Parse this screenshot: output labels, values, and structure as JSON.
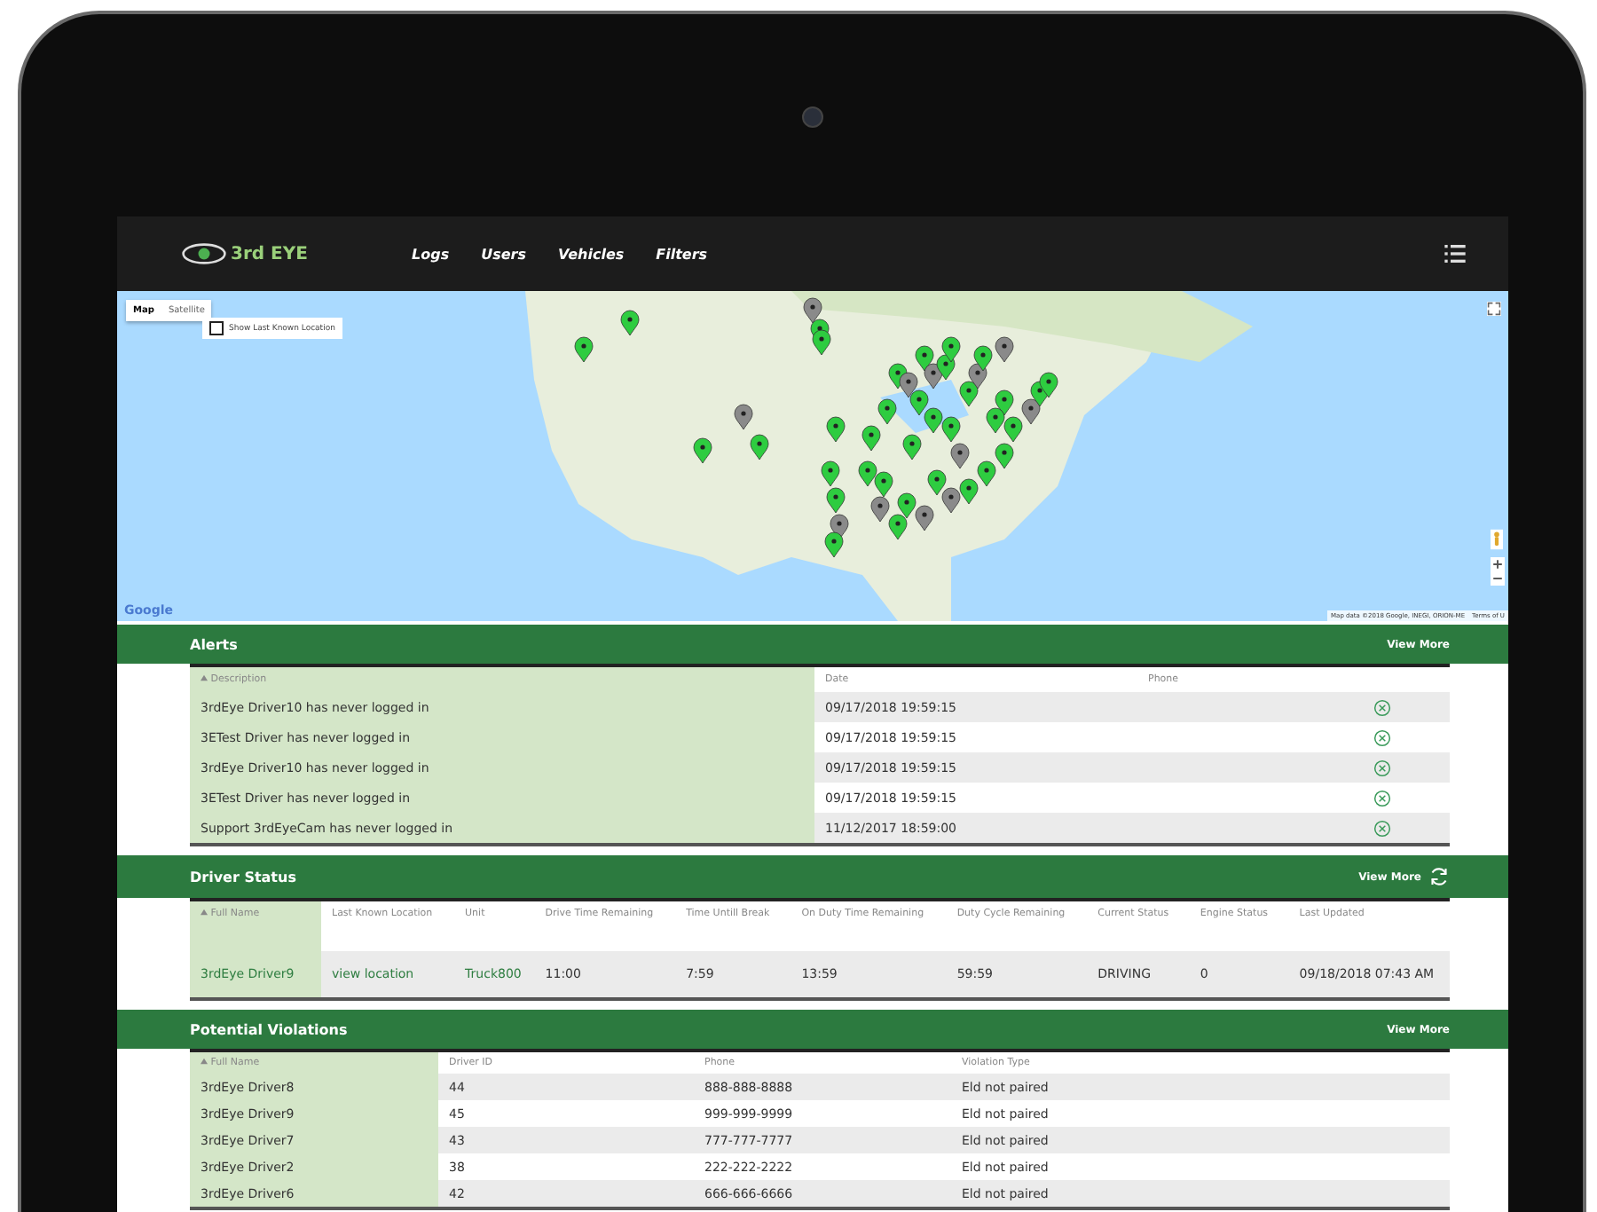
{
  "nav": {
    "logo": "3rd EYE",
    "items": [
      {
        "label": "Logs"
      },
      {
        "label": "Users"
      },
      {
        "label": "Vehicles"
      },
      {
        "label": "Filters"
      }
    ]
  },
  "map": {
    "tabs": [
      {
        "label": "Map",
        "selected": true
      },
      {
        "label": "Satellite",
        "selected": false
      }
    ],
    "show_last_known": {
      "label": "Show Last Known Location",
      "checked": false
    },
    "logo": "Google",
    "attribution": "Map data ©2018 Google, INEGI, ORION-ME",
    "terms": "Terms of U"
  },
  "alerts": {
    "title": "Alerts",
    "view_more": "View More",
    "columns": [
      {
        "label": "Description",
        "sorted": true
      },
      {
        "label": "Date",
        "sorted": false
      },
      {
        "label": "Phone",
        "sorted": false
      }
    ],
    "rows": [
      [
        "3rdEye Driver10 has never logged in",
        "09/17/2018 19:59:15",
        ""
      ],
      [
        "3ETest Driver has never logged in",
        "09/17/2018 19:59:15",
        ""
      ],
      [
        "3rdEye Driver10 has never logged in",
        "09/17/2018 19:59:15",
        ""
      ],
      [
        "3ETest Driver has never logged in",
        "09/17/2018 19:59:15",
        ""
      ],
      [
        "Support 3rdEyeCam has never logged in",
        "11/12/2017 18:59:00",
        ""
      ]
    ]
  },
  "driver_status": {
    "title": "Driver Status",
    "view_more": "View More",
    "columns": [
      {
        "label": "Full Name",
        "sorted": true
      },
      {
        "label": "Last Known Location",
        "sorted": false
      },
      {
        "label": "Unit",
        "sorted": false
      },
      {
        "label": "Drive Time Remaining",
        "sorted": false
      },
      {
        "label": "Time Untill Break",
        "sorted": false
      },
      {
        "label": "On Duty Time Remaining",
        "sorted": false
      },
      {
        "label": "Duty Cycle Remaining",
        "sorted": false
      },
      {
        "label": "Current Status",
        "sorted": false
      },
      {
        "label": "Engine Status",
        "sorted": false
      },
      {
        "label": "Last Updated",
        "sorted": false
      }
    ],
    "rows": [
      [
        {
          "text": "3rdEye Driver9",
          "kind": "link"
        },
        {
          "text": "view location",
          "kind": "link"
        },
        {
          "text": "Truck800",
          "kind": "link"
        },
        {
          "text": "11:00",
          "kind": "text"
        },
        {
          "text": "7:59",
          "kind": "text"
        },
        {
          "text": "13:59",
          "kind": "text"
        },
        {
          "text": "59:59",
          "kind": "text"
        },
        {
          "text": "DRIVING",
          "kind": "text"
        },
        {
          "text": "0",
          "kind": "text"
        },
        {
          "text": "09/18/2018 07:43 AM",
          "kind": "text"
        }
      ]
    ]
  },
  "violations": {
    "title": "Potential Violations",
    "view_more": "View More",
    "columns": [
      {
        "label": "Full Name",
        "sorted": true
      },
      {
        "label": "Driver ID",
        "sorted": false
      },
      {
        "label": "Phone",
        "sorted": false
      },
      {
        "label": "Violation Type",
        "sorted": false
      }
    ],
    "rows": [
      [
        "3rdEye Driver8",
        "44",
        "888-888-8888",
        "Eld not paired"
      ],
      [
        "3rdEye Driver9",
        "45",
        "999-999-9999",
        "Eld not paired"
      ],
      [
        "3rdEye Driver7",
        "43",
        "777-777-7777",
        "Eld not paired"
      ],
      [
        "3rdEye Driver2",
        "38",
        "222-222-2222",
        "Eld not paired"
      ],
      [
        "3rdEye Driver6",
        "42",
        "666-666-6666",
        "Eld not paired"
      ]
    ]
  }
}
